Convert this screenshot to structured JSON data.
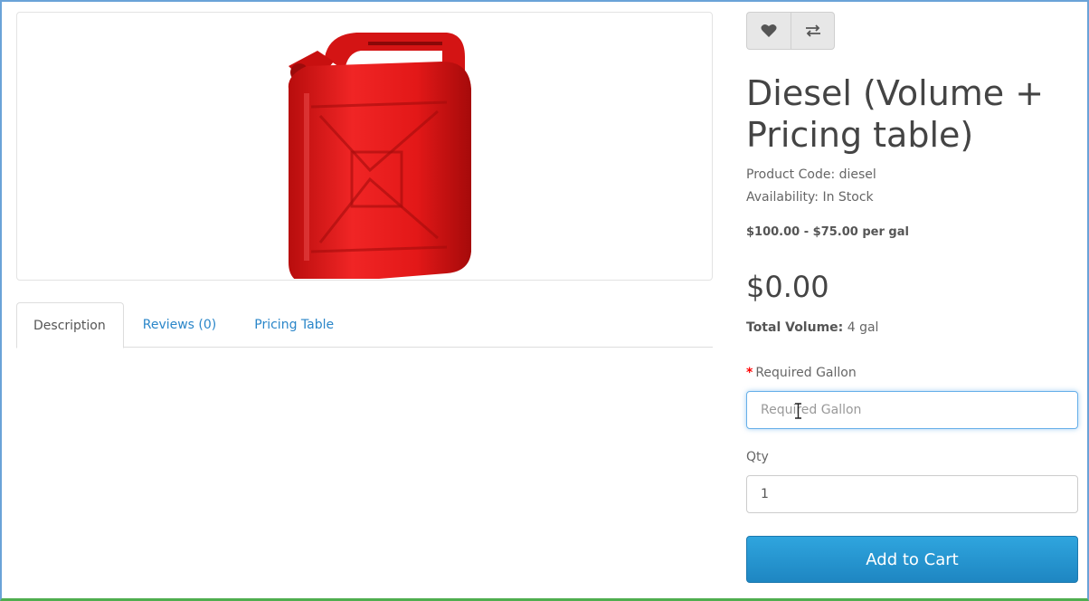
{
  "product": {
    "title": "Diesel (Volume + Pricing table)",
    "product_code": "Product Code: diesel",
    "availability": "Availability: In Stock",
    "price_range": "$100.00 - $75.00 per gal",
    "price": "$0.00",
    "total_volume_label": "Total Volume:",
    "total_volume_value": " 4 gal"
  },
  "tabs": [
    {
      "label": "Description",
      "active": true
    },
    {
      "label": "Reviews (0)",
      "active": false
    },
    {
      "label": "Pricing Table",
      "active": false
    }
  ],
  "actions": {
    "wishlist_icon": "heart-icon",
    "compare_icon": "compare-arrows-icon"
  },
  "form": {
    "gallon_label": "Required Gallon",
    "gallon_required_mark": "*",
    "gallon_placeholder": "Required Gallon",
    "gallon_value": "",
    "qty_label": "Qty",
    "qty_value": "1",
    "add_to_cart": "Add to Cart"
  },
  "colors": {
    "accent": "#2a86c9",
    "button": "#2295d0",
    "can_red": "#e01818"
  }
}
